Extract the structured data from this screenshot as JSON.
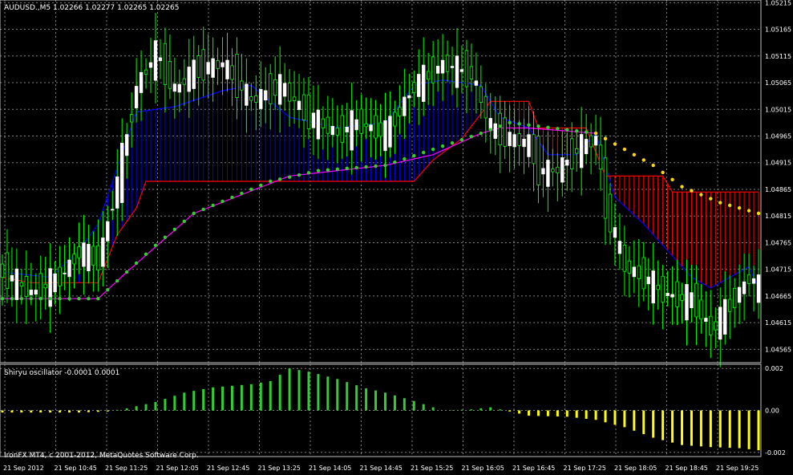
{
  "main_header": "AUDUSD.,M5  1.02266 1.02277 1.02265 1.02265",
  "sub_header": "Shiryu oscillator -0.0001 0.0001",
  "copyright": "IronFX MT4, c 2001-2012, MetaQuotes Software Corp.",
  "colors": {
    "background": "#000000",
    "grid": "#808080",
    "border": "#c0c0c0",
    "bull_candle": "#ffffff",
    "candle_wick": "#00ff00",
    "tenkan": "#0000ff",
    "kijun": "#ff0000",
    "cloud_up": "#0000ff",
    "cloud_down": "#ff0000",
    "chikou": "#ff00ff",
    "ma_green": "#32cd32",
    "ma_yellow": "#ffd700",
    "osc_positive": "#32cd32",
    "osc_negative": "#ffff00"
  },
  "chart_data": [
    {
      "type": "candlestick",
      "title": "AUDUSD.,M5  1.02266 1.02277 1.02265 1.02265",
      "ylim": [
        1.0454,
        1.0522
      ],
      "y_ticks": [
        "1.05215",
        "1.05165",
        "1.05115",
        "1.05065",
        "1.05015",
        "1.04965",
        "1.04915",
        "1.04865",
        "1.04815",
        "1.04765",
        "1.04715",
        "1.04665",
        "1.04615",
        "1.04565"
      ],
      "x_ticks": [
        "21 Sep 2012",
        "21 Sep 10:45",
        "21 Sep 11:25",
        "21 Sep 12:05",
        "21 Sep 12:45",
        "21 Sep 13:25",
        "21 Sep 14:05",
        "21 Sep 14:45",
        "21 Sep 15:25",
        "21 Sep 16:05",
        "21 Sep 16:45",
        "21 Sep 17:25",
        "21 Sep 18:05",
        "21 Sep 18:45",
        "21 Sep 19:25"
      ],
      "price_anchors": [
        [
          0,
          1.0471
        ],
        [
          6,
          1.0467
        ],
        [
          12,
          1.047
        ],
        [
          16,
          1.0475
        ],
        [
          20,
          1.0473
        ],
        [
          24,
          1.0488
        ],
        [
          28,
          1.0506
        ],
        [
          32,
          1.0512
        ],
        [
          36,
          1.0505
        ],
        [
          40,
          1.0509
        ],
        [
          46,
          1.051
        ],
        [
          52,
          1.0503
        ],
        [
          58,
          1.0506
        ],
        [
          64,
          1.05
        ],
        [
          70,
          1.0497
        ],
        [
          74,
          1.0499
        ],
        [
          80,
          1.0497
        ],
        [
          86,
          1.0506
        ],
        [
          92,
          1.051
        ],
        [
          98,
          1.0508
        ],
        [
          102,
          1.0498
        ],
        [
          106,
          1.0496
        ],
        [
          110,
          1.0495
        ],
        [
          112,
          1.049
        ],
        [
          116,
          1.049
        ],
        [
          120,
          1.0494
        ],
        [
          124,
          1.0496
        ],
        [
          126,
          1.0483
        ],
        [
          130,
          1.0472
        ],
        [
          134,
          1.047
        ],
        [
          138,
          1.0467
        ],
        [
          142,
          1.0466
        ],
        [
          144,
          1.0466
        ],
        [
          148,
          1.046
        ],
        [
          152,
          1.0465
        ],
        [
          156,
          1.047
        ],
        [
          158,
          1.0468
        ]
      ],
      "ichimoku": {
        "tenkan_anchors": [
          [
            0,
            1.0471
          ],
          [
            10,
            1.047
          ],
          [
            16,
            1.0475
          ],
          [
            20,
            1.048
          ],
          [
            28,
            1.0501
          ],
          [
            36,
            1.0502
          ],
          [
            46,
            1.0505
          ],
          [
            52,
            1.0506
          ],
          [
            60,
            1.05
          ],
          [
            70,
            1.0498
          ],
          [
            80,
            1.0499
          ],
          [
            86,
            1.0506
          ],
          [
            92,
            1.0507
          ],
          [
            100,
            1.0506
          ],
          [
            104,
            1.05
          ],
          [
            110,
            1.0498
          ],
          [
            114,
            1.0493
          ],
          [
            120,
            1.0493
          ],
          [
            124,
            1.0497
          ],
          [
            128,
            1.0485
          ],
          [
            134,
            1.048
          ],
          [
            140,
            1.0474
          ],
          [
            144,
            1.047
          ],
          [
            148,
            1.0468
          ],
          [
            152,
            1.047
          ],
          [
            156,
            1.0472
          ],
          [
            158,
            1.0468
          ]
        ],
        "kijun_anchors": [
          [
            0,
            1.047
          ],
          [
            6,
            1.0469
          ],
          [
            20,
            1.0469
          ],
          [
            24,
            1.0478
          ],
          [
            28,
            1.0483
          ],
          [
            30,
            1.0488
          ],
          [
            86,
            1.0488
          ],
          [
            90,
            1.0492
          ],
          [
            96,
            1.0496
          ],
          [
            102,
            1.0503
          ],
          [
            110,
            1.0503
          ],
          [
            112,
            1.0498
          ],
          [
            122,
            1.0498
          ],
          [
            126,
            1.0489
          ],
          [
            138,
            1.0489
          ],
          [
            140,
            1.0486
          ],
          [
            158,
            1.0486
          ]
        ],
        "chikou_anchors": [
          [
            0,
            1.0466
          ],
          [
            20,
            1.0466
          ],
          [
            26,
            1.0471
          ],
          [
            40,
            1.0482
          ],
          [
            60,
            1.0489
          ],
          [
            80,
            1.0491
          ],
          [
            90,
            1.0493
          ],
          [
            100,
            1.0497
          ],
          [
            104,
            1.0498
          ],
          [
            110,
            1.0498
          ],
          [
            124,
            1.0497
          ]
        ]
      },
      "ma_anchors": [
        [
          0,
          1.0466
        ],
        [
          20,
          1.0466
        ],
        [
          26,
          1.0471
        ],
        [
          32,
          1.0476
        ],
        [
          40,
          1.0482
        ],
        [
          48,
          1.0485
        ],
        [
          56,
          1.0488
        ],
        [
          66,
          1.049
        ],
        [
          80,
          1.0491
        ],
        [
          90,
          1.0494
        ],
        [
          100,
          1.0497
        ],
        [
          106,
          1.0499
        ],
        [
          124,
          1.0497
        ],
        [
          130,
          1.0494
        ],
        [
          136,
          1.0491
        ],
        [
          142,
          1.0487
        ],
        [
          150,
          1.0484
        ],
        [
          158,
          1.0482
        ]
      ],
      "ma_yellow_from_index": 124
    },
    {
      "type": "bar",
      "title": "Shiryu oscillator -0.0001 0.0001",
      "ylim": [
        -0.0022,
        0.0022
      ],
      "y_ticks": [
        "0.002",
        "0.00",
        "-0.002"
      ],
      "anchors": [
        [
          0,
          -0.0001
        ],
        [
          16,
          -0.0001
        ],
        [
          22,
          -5e-05
        ],
        [
          26,
          0.0001
        ],
        [
          32,
          0.0004
        ],
        [
          38,
          0.00085
        ],
        [
          44,
          0.0011
        ],
        [
          52,
          0.00125
        ],
        [
          56,
          0.0014
        ],
        [
          60,
          0.002
        ],
        [
          64,
          0.00185
        ],
        [
          70,
          0.0015
        ],
        [
          76,
          0.00105
        ],
        [
          80,
          0.00085
        ],
        [
          86,
          0.00045
        ],
        [
          92,
          0.0
        ],
        [
          98,
          5e-05
        ],
        [
          102,
          0.00015
        ],
        [
          106,
          -5e-05
        ],
        [
          110,
          -0.00025
        ],
        [
          118,
          -0.0003
        ],
        [
          124,
          -0.00045
        ],
        [
          130,
          -0.0008
        ],
        [
          136,
          -0.0013
        ],
        [
          142,
          -0.00165
        ],
        [
          148,
          -0.00175
        ],
        [
          154,
          -0.0018
        ],
        [
          158,
          -0.0019
        ]
      ]
    }
  ]
}
